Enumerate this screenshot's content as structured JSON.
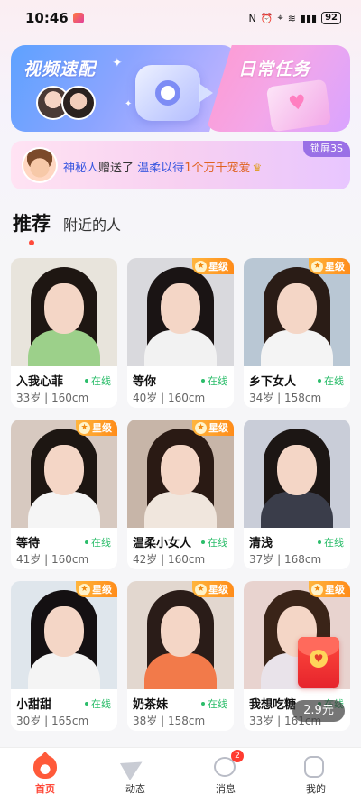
{
  "status_bar": {
    "time": "10:46",
    "battery": "92"
  },
  "banners": {
    "video_match": "视频速配",
    "daily_tasks": "日常任务"
  },
  "notice": {
    "prefix": "神秘人",
    "verb": "赠送了",
    "recipient": "温柔以待",
    "gift": "1个万千宠爱",
    "lock_tag": "锁屏3S"
  },
  "tabs": {
    "recommend": "推荐",
    "nearby": "附近的人"
  },
  "vip_label": "星级",
  "online_label": "在线",
  "colors": {
    "accent": "#ff4a3a",
    "online": "#2bbd6a",
    "vip": "#ff9a26"
  },
  "cards": [
    {
      "name": "入我心菲",
      "meta": "33岁 | 160cm",
      "online": "在线",
      "vip": false
    },
    {
      "name": "等你",
      "meta": "40岁 | 160cm",
      "online": "在线",
      "vip": true
    },
    {
      "name": "乡下女人",
      "meta": "34岁 | 158cm",
      "online": "在线",
      "vip": true
    },
    {
      "name": "等待",
      "meta": "41岁 | 160cm",
      "online": "在线",
      "vip": true
    },
    {
      "name": "温柔小女人",
      "meta": "42岁 | 160cm",
      "online": "在线",
      "vip": true
    },
    {
      "name": "清浅",
      "meta": "37岁 | 168cm",
      "online": "在线",
      "vip": false
    },
    {
      "name": "小甜甜",
      "meta": "30岁 | 165cm",
      "online": "在线",
      "vip": true
    },
    {
      "name": "奶茶妹",
      "meta": "38岁 | 158cm",
      "online": "在线",
      "vip": true
    },
    {
      "name": "我想吃糖",
      "meta": "33岁 | 161cm",
      "online": "在线",
      "vip": true
    }
  ],
  "red_envelope": {
    "price": "2.9元"
  },
  "bottom_nav": {
    "home": "首页",
    "moments": "动态",
    "messages": "消息",
    "messages_badge": "2",
    "mine": "我的"
  }
}
